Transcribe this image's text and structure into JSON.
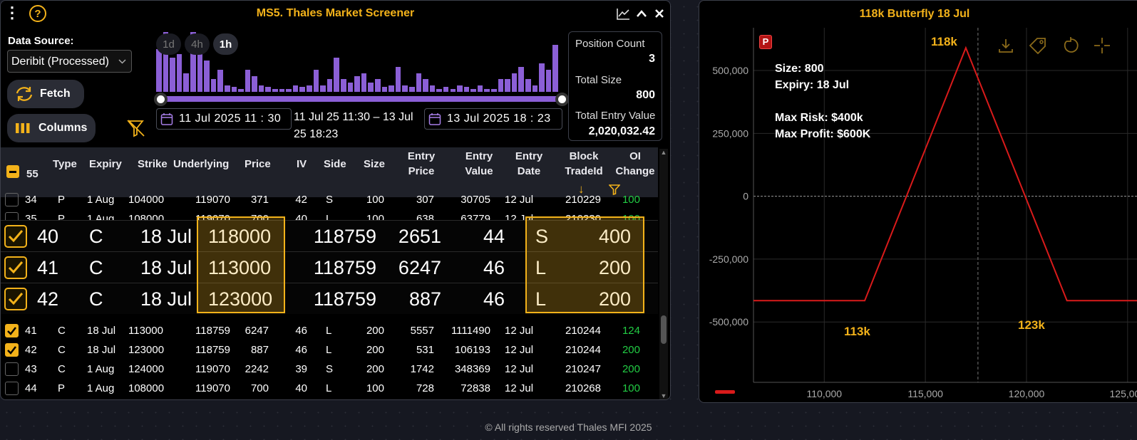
{
  "screener": {
    "title": "MS5. Thales Market Screener",
    "data_source_label": "Data Source:",
    "data_source_value": "Deribit (Processed)",
    "fetch_label": "Fetch",
    "columns_label": "Columns",
    "timeframes": [
      "1d",
      "4h",
      "1h"
    ],
    "start_date": "11  Jul   2025   11 : 30",
    "end_date": "13  Jul   2025   18 : 23",
    "range_text_1": "11 Jul 25 11:30 – 13 Jul",
    "range_text_2": "25 18:23",
    "histogram": [
      0.68,
      0.95,
      0.55,
      0.6,
      0.3,
      0.95,
      0.7,
      0.5,
      0.2,
      0.35,
      0.1,
      0.08,
      0.05,
      0.35,
      0.25,
      0.1,
      0.08,
      0.05,
      0.05,
      0.05,
      0.1,
      0.08,
      0.1,
      0.35,
      0.1,
      0.2,
      0.55,
      0.2,
      0.15,
      0.25,
      0.3,
      0.15,
      0.2,
      0.08,
      0.1,
      0.4,
      0.1,
      0.08,
      0.3,
      0.2,
      0.1,
      0.05,
      0.08,
      0.05,
      0.1,
      0.08,
      0.05,
      0.1,
      0.05,
      0.05,
      0.2,
      0.2,
      0.3,
      0.4,
      0.2,
      0.1,
      0.45,
      0.35,
      0.75
    ],
    "stats": {
      "position_count_label": "Position Count",
      "position_count": "3",
      "total_size_label": "Total Size",
      "total_size": "800",
      "total_entry_label": "Total Entry Value",
      "total_entry": "2,020,032.42"
    },
    "select_count": "55",
    "headers": {
      "type": "Type",
      "expiry": "Expiry",
      "strike": "Strike",
      "underlying": "Underlying",
      "price": "Price",
      "iv": "IV",
      "side": "Side",
      "size": "Size",
      "entry_price_1": "Entry",
      "entry_price_2": "Price",
      "entry_value_1": "Entry",
      "entry_value_2": "Value",
      "entry_date_1": "Entry",
      "entry_date_2": "Date",
      "block_1": "Block",
      "block_2": "TradeId",
      "oi_1": "OI",
      "oi_2": "Change",
      "sort_icon": "↓"
    },
    "rows_top": [
      {
        "id": "34",
        "type": "P",
        "expiry": "1 Aug",
        "strike": "104000",
        "underlying": "119070",
        "price": "371",
        "iv": "42",
        "side": "S",
        "size": "100",
        "entry_price": "307",
        "entry_value": "30705",
        "entry_date": "12 Jul",
        "block": "210229",
        "oi": "100",
        "checked": false
      },
      {
        "id": "35",
        "type": "P",
        "expiry": "1 Aug",
        "strike": "108000",
        "underlying": "119070",
        "price": "700",
        "iv": "40",
        "side": "L",
        "size": "100",
        "entry_price": "638",
        "entry_value": "63779",
        "entry_date": "12 Jul",
        "block": "210230",
        "oi": "100",
        "checked": false
      }
    ],
    "rows_zoom": [
      {
        "id": "40",
        "type": "C",
        "expiry": "18 Jul",
        "strike": "118000",
        "underlying": "118759",
        "price": "2651",
        "iv": "44",
        "side": "S",
        "size": "400"
      },
      {
        "id": "41",
        "type": "C",
        "expiry": "18 Jul",
        "strike": "113000",
        "underlying": "118759",
        "price": "6247",
        "iv": "46",
        "side": "L",
        "size": "200"
      },
      {
        "id": "42",
        "type": "C",
        "expiry": "18 Jul",
        "strike": "123000",
        "underlying": "118759",
        "price": "887",
        "iv": "46",
        "side": "L",
        "size": "200"
      }
    ],
    "rows_bottom": [
      {
        "id": "41",
        "type": "C",
        "expiry": "18 Jul",
        "strike": "113000",
        "underlying": "118759",
        "price": "6247",
        "iv": "46",
        "side": "L",
        "size": "200",
        "entry_price": "5557",
        "entry_value": "1111490",
        "entry_date": "12 Jul",
        "block": "210244",
        "oi": "124",
        "checked": true
      },
      {
        "id": "42",
        "type": "C",
        "expiry": "18 Jul",
        "strike": "123000",
        "underlying": "118759",
        "price": "887",
        "iv": "46",
        "side": "L",
        "size": "200",
        "entry_price": "531",
        "entry_value": "106193",
        "entry_date": "12 Jul",
        "block": "210244",
        "oi": "200",
        "checked": true
      },
      {
        "id": "43",
        "type": "C",
        "expiry": "1 Aug",
        "strike": "124000",
        "underlying": "119070",
        "price": "2242",
        "iv": "39",
        "side": "S",
        "size": "200",
        "entry_price": "1742",
        "entry_value": "348369",
        "entry_date": "12 Jul",
        "block": "210247",
        "oi": "200",
        "checked": false
      },
      {
        "id": "44",
        "type": "P",
        "expiry": "1 Aug",
        "strike": "108000",
        "underlying": "119070",
        "price": "700",
        "iv": "40",
        "side": "L",
        "size": "100",
        "entry_price": "728",
        "entry_value": "72838",
        "entry_date": "12 Jul",
        "block": "210268",
        "oi": "100",
        "checked": false
      }
    ]
  },
  "payoff": {
    "title": "118k Butterfly 18 Jul",
    "badge": "P",
    "info": [
      "Size: 800",
      "Expiry: 18 Jul",
      "",
      "Max Risk: $400k",
      "Max Profit: $600K"
    ],
    "peak_label": "118k",
    "left_label": "113k",
    "right_label": "123k"
  },
  "chart_data": {
    "type": "line",
    "title": "118k Butterfly 18 Jul",
    "xlabel": "",
    "ylabel": "",
    "x_ticks": [
      "110,000",
      "115,000",
      "120,000",
      "125,000"
    ],
    "y_ticks": [
      "500,000",
      "250,000",
      "0",
      "-250,000",
      "-500,000"
    ],
    "xlim": [
      106500,
      125500
    ],
    "ylim": [
      -740000,
      670000
    ],
    "series": [
      {
        "x": [
          106500,
          112000,
          117000,
          122000,
          125500
        ],
        "y": [
          -415000,
          -415000,
          590000,
          -415000,
          -415000
        ],
        "color": "#d91a1a"
      }
    ],
    "vline": 117600,
    "grid": true
  },
  "footer": "© All rights reserved Thales MFI 2025",
  "colors": {
    "accent": "#f3b21a",
    "histogram": "#8b5fd6",
    "payoff": "#d91a1a",
    "oi": "#22cc44"
  }
}
